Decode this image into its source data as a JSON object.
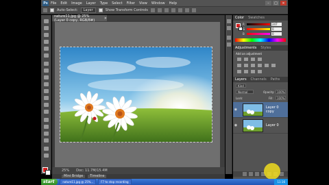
{
  "app": {
    "logo": "Ps"
  },
  "menu": [
    "File",
    "Edit",
    "Image",
    "Layer",
    "Type",
    "Select",
    "Filter",
    "View",
    "Window",
    "Help"
  ],
  "options": {
    "auto_select_label": "Auto-Select:",
    "auto_select_value": "Layer",
    "show_transform_label": "Show Transform Controls"
  },
  "document": {
    "tab_title": "nature11.jpg @ 25% (Layer 0 copy, RGB/8#)",
    "zoom": "25%",
    "doc_size": "Doc: 11.7M/15.4M"
  },
  "bottom_tabs": [
    "Mini Bridge",
    "Timeline"
  ],
  "panels": {
    "color_tabs": [
      "Color",
      "Swatches"
    ],
    "color": {
      "r": "247",
      "g": "0",
      "b": "0",
      "r_label": "R",
      "g_label": "G",
      "b_label": "B"
    },
    "adjust_tabs": [
      "Adjustments",
      "Styles"
    ],
    "adjust_title": "Add an adjustment",
    "layer_tabs": [
      "Layers",
      "Channels",
      "Paths"
    ],
    "kind_label": "Kind",
    "blend_mode": "Normal",
    "opacity_label": "Opacity:",
    "opacity_value": "100%",
    "lock_label": "Lock:",
    "fill_label": "Fill:",
    "fill_value": "100%",
    "layers": [
      {
        "name": "Layer 0 copy",
        "selected": true
      },
      {
        "name": "Layer 0",
        "selected": false
      }
    ]
  },
  "taskbar": {
    "start_label": "start",
    "tasks": [
      "nature11.jpg @ 25%...",
      "F7 to stop recording"
    ],
    "clock": "11:16"
  },
  "colors": {
    "foreground": "#d21f1f",
    "background": "#ffffff",
    "selected_layer": "#4f6f9a"
  },
  "icons": [
    "move-tool-icon",
    "marquee-tool-icon",
    "lasso-tool-icon",
    "quick-select-tool-icon",
    "crop-tool-icon",
    "eyedropper-tool-icon",
    "healing-brush-icon",
    "brush-tool-icon",
    "clone-stamp-icon",
    "history-brush-icon",
    "eraser-tool-icon",
    "gradient-tool-icon",
    "blur-tool-icon",
    "dodge-tool-icon",
    "pen-tool-icon",
    "type-tool-icon",
    "path-select-icon",
    "shape-tool-icon",
    "hand-tool-icon",
    "zoom-tool-icon",
    "eye-icon"
  ]
}
